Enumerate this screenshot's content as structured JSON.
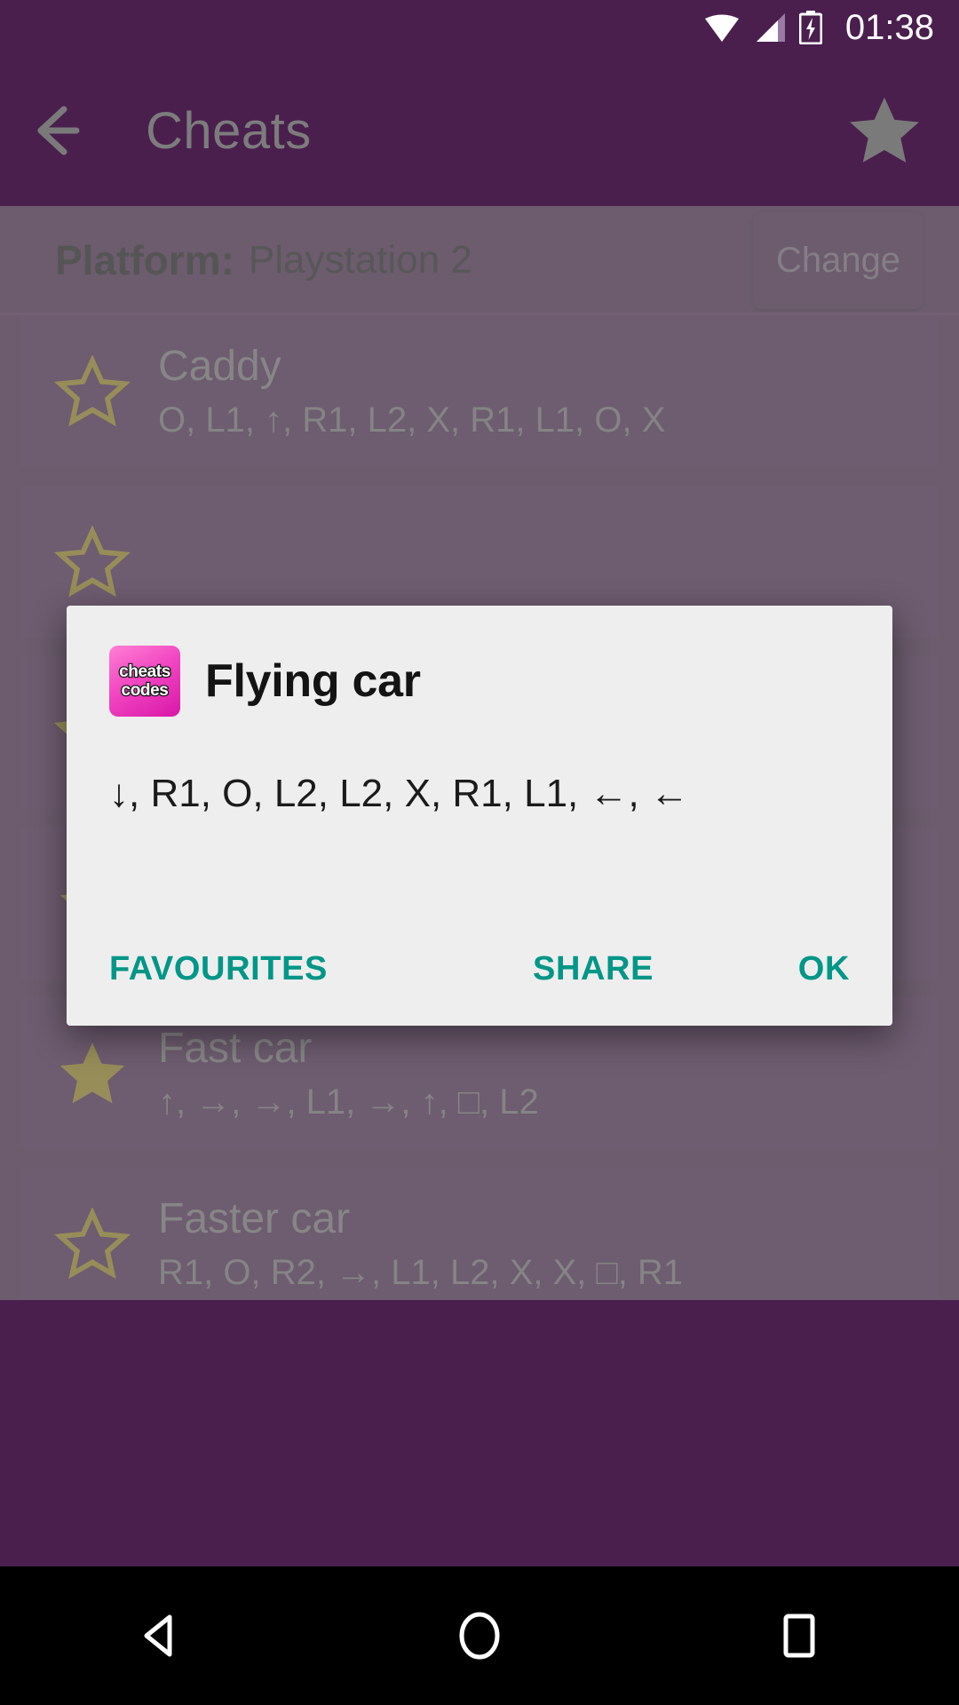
{
  "status_bar": {
    "time": "01:38",
    "icons": [
      "wifi-icon",
      "signal-icon",
      "battery-charging-icon"
    ]
  },
  "app_bar": {
    "back_icon": "back-arrow-icon",
    "title": "Cheats",
    "favourite_icon": "star-filled-icon"
  },
  "platform": {
    "label": "Platform:",
    "value": "Playstation 2",
    "change_button": "Change"
  },
  "cheats": [
    {
      "title": "Caddy",
      "code": "O, L1, ↑, R1, L2, X, R1, L1, O, X",
      "favourite": false
    },
    {
      "title": "",
      "code": "",
      "favourite": false
    },
    {
      "title": "",
      "code": "",
      "favourite": false
    },
    {
      "title": "",
      "code": "↓, R1, O, L2, L2, X, R1, L1, ←, ←",
      "favourite": true
    },
    {
      "title": "Fast car",
      "code": "↑, →, →, L1, →, ↑, □, L2",
      "favourite": true
    },
    {
      "title": "Faster car",
      "code": "R1, O, R2, →, L1, L2, X, X, □, R1",
      "favourite": false
    }
  ],
  "dialog": {
    "icon_name": "cheats-codes-app-icon",
    "icon_line1": "cheats",
    "icon_line2": "codes",
    "title": "Flying car",
    "message": "↓, R1, O, L2, L2, X, R1, L1,  ←,  ←",
    "buttons": {
      "favourites": "FAVOURITES",
      "share": "SHARE",
      "ok": "OK"
    }
  },
  "nav_bar": {
    "back": "nav-back-icon",
    "home": "nav-home-icon",
    "recents": "nav-recents-icon"
  },
  "colors": {
    "primary_purple": "#4a1f4e",
    "card_purple": "#4f2055",
    "accent_teal": "#009688",
    "star_gold": "#bfa216",
    "dialog_bg": "#eeeeee"
  }
}
